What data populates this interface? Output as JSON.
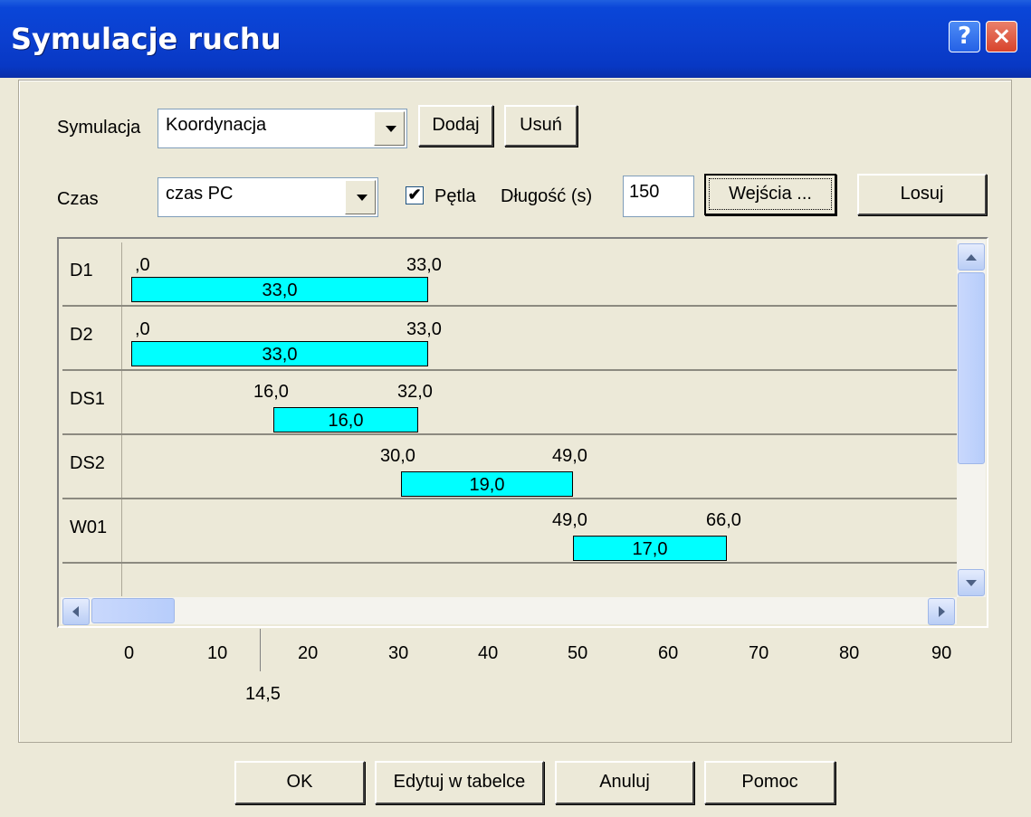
{
  "window": {
    "title": "Symulacje ruchu",
    "help": "?",
    "close": "×"
  },
  "simulation": {
    "label": "Symulacja",
    "value": "Koordynacja",
    "add": "Dodaj",
    "remove": "Usuń"
  },
  "time": {
    "label": "Czas",
    "value": "czas PC",
    "loop_label": "Pętla",
    "loop_checked": "✔",
    "length_label": "Długość (s)",
    "length_value": "150",
    "inputs": "Wejścia ...",
    "random": "Losuj"
  },
  "rows": [
    {
      "name": "D1",
      "start": ",0",
      "end": "33,0",
      "dur": "33,0"
    },
    {
      "name": "D2",
      "start": ",0",
      "end": "33,0",
      "dur": "33,0"
    },
    {
      "name": "DS1",
      "start": "16,0",
      "end": "32,0",
      "dur": "16,0"
    },
    {
      "name": "DS2",
      "start": "30,0",
      "end": "49,0",
      "dur": "19,0"
    },
    {
      "name": "W01",
      "start": "49,0",
      "end": "66,0",
      "dur": "17,0"
    }
  ],
  "axis": {
    "ticks": [
      "0",
      "10",
      "20",
      "30",
      "40",
      "50",
      "60",
      "70",
      "80",
      "90"
    ],
    "cursor": "14,5"
  },
  "buttons": {
    "ok": "OK",
    "edit": "Edytuj w tabelce",
    "cancel": "Anuluj",
    "help": "Pomoc"
  }
}
